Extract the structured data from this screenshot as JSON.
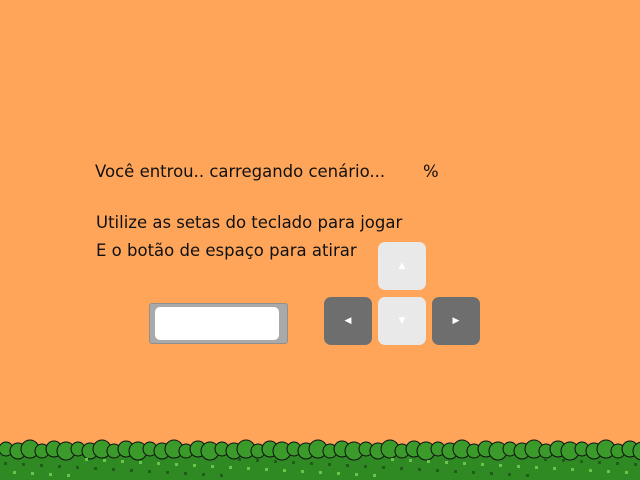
{
  "loading": {
    "text": "Você entrou.. carregando cenário...",
    "percent": "%"
  },
  "instructions": {
    "line1": "Utilize as setas do teclado para jogar",
    "line2": "E o botão de espaço para atirar"
  },
  "controls": {
    "space_key_icon": "spacebar-key",
    "up_icon": "▲",
    "left_icon": "◀",
    "down_icon": "▼",
    "right_icon": "▶"
  },
  "colors": {
    "background": "#fea55a",
    "key_light": "#e9e9e9",
    "key_dark": "#6e6e6e",
    "grass": "#3a9a2a"
  }
}
